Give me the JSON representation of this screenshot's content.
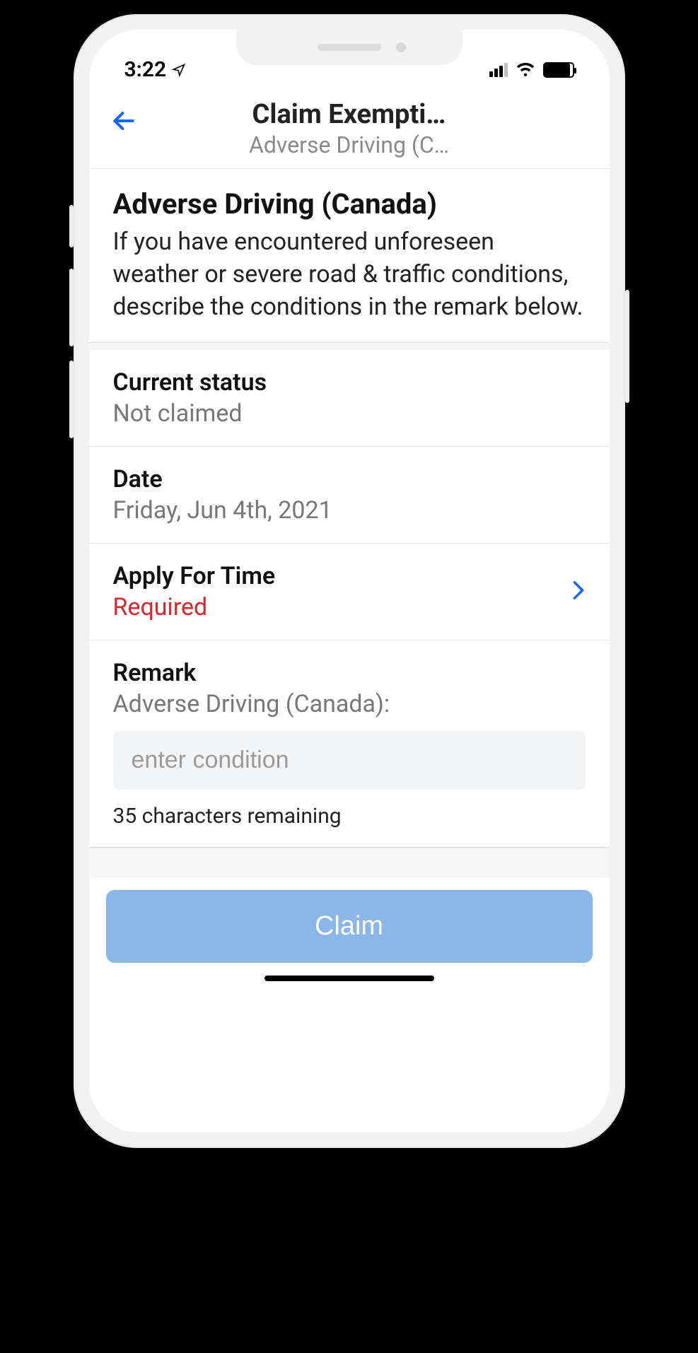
{
  "status_bar": {
    "time": "3:22"
  },
  "header": {
    "title": "Claim Exempti…",
    "subtitle": "Adverse Driving (C…"
  },
  "intro": {
    "title": "Adverse Driving (Canada)",
    "description": "If you have encountered unforeseen weather or severe road & traffic conditions, describe the conditions in the remark below."
  },
  "status": {
    "label": "Current status",
    "value": "Not claimed"
  },
  "date": {
    "label": "Date",
    "value": "Friday, Jun 4th, 2021"
  },
  "apply_time": {
    "label": "Apply For Time",
    "value": "Required"
  },
  "remark": {
    "label": "Remark",
    "sublabel": "Adverse Driving (Canada):",
    "placeholder": "enter condition",
    "remaining": "35 characters remaining"
  },
  "footer": {
    "claim_label": "Claim"
  }
}
